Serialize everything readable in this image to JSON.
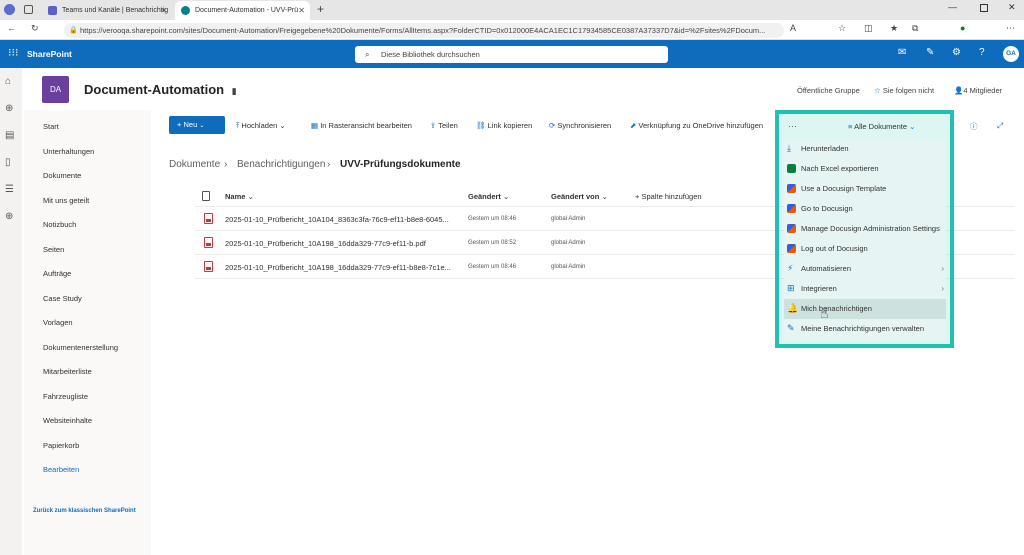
{
  "browser": {
    "tabs": [
      {
        "label": "Teams und Kanäle | Benachrichtig"
      },
      {
        "label": "Document-Automation - UVV-Prü"
      }
    ],
    "url": "https://verooqa.sharepoint.com/sites/Document-Automation/Freigegebene%20Dokumente/Forms/AllItems.aspx?FolderCTID=0x012000E4ACA1EC1C17934585CE0387A37337D7&id=%2Fsites%2FDocum..."
  },
  "suite": {
    "brand": "SharePoint",
    "search_placeholder": "Diese Bibliothek durchsuchen",
    "avatar": "GA"
  },
  "site": {
    "logo": "DA",
    "title": "Document-Automation",
    "group": "Öffentliche Gruppe",
    "follow": "Sie folgen nicht",
    "members": "4 Mitglieder"
  },
  "nav": {
    "items": [
      "Start",
      "Unterhaltungen",
      "Dokumente",
      "Mit uns geteilt",
      "Notizbuch",
      "Seiten",
      "Aufträge",
      "Case Study",
      "Vorlagen",
      "Dokumentenerstellung",
      "Mitarbeiterliste",
      "Fahrzeugliste",
      "Websiteinhalte",
      "Papierkorb"
    ],
    "edit": "Bearbeiten",
    "classic": "Zurück zum klassischen SharePoint"
  },
  "commands": {
    "new": "Neu",
    "upload": "Hochladen",
    "grid": "In Rasteransicht bearbeiten",
    "share": "Teilen",
    "copylink": "Link kopieren",
    "sync": "Synchronisieren",
    "onedrive": "Verknüpfung zu OneDrive hinzufügen",
    "more": "···",
    "view": "Alle Dokumente"
  },
  "breadcrumb": [
    "Dokumente",
    "Benachrichtigungen",
    "UVV-Prüfungsdokumente"
  ],
  "columns": {
    "name": "Name",
    "modified": "Geändert",
    "modified_by": "Geändert von",
    "add": "Spalte hinzufügen"
  },
  "files": [
    {
      "name": "2025-01-10_Prüfbericht_10A104_8363c3fa-76c9-ef11-b8e8-6045...",
      "modified": "Gestern um 08:46",
      "by": "global Admin"
    },
    {
      "name": "2025-01-10_Prüfbericht_10A198_16dda329-77c9-ef11-b.pdf",
      "modified": "Gestern um 08:52",
      "by": "global Admin"
    },
    {
      "name": "2025-01-10_Prüfbericht_10A198_16dda329-77c9-ef11-b8e8-7c1e...",
      "modified": "Gestern um 08:46",
      "by": "global Admin"
    }
  ],
  "menu": [
    {
      "label": "Herunterladen",
      "icon": "download-icon",
      "color": "#0f6cbd"
    },
    {
      "label": "Nach Excel exportieren",
      "icon": "excel-icon",
      "color": "#107c41"
    },
    {
      "label": "Use a Docusign Template",
      "icon": "docusign-icon",
      "color": "#3b5bdb"
    },
    {
      "label": "Go to Docusign",
      "icon": "docusign-icon",
      "color": "#3b5bdb"
    },
    {
      "label": "Manage Docusign Administration Settings",
      "icon": "docusign-icon",
      "color": "#3b5bdb"
    },
    {
      "label": "Log out of Docusign",
      "icon": "docusign-icon",
      "color": "#3b5bdb"
    },
    {
      "label": "Automatisieren",
      "icon": "automate-icon",
      "color": "#0f6cbd",
      "sub": "›"
    },
    {
      "label": "Integrieren",
      "icon": "integrate-icon",
      "color": "#0f6cbd",
      "sub": "›"
    },
    {
      "label": "Mich benachrichtigen",
      "icon": "bell-icon",
      "color": "#0f6cbd"
    },
    {
      "label": "Meine Benachrichtigungen verwalten",
      "icon": "manage-alerts-icon",
      "color": "#0f6cbd"
    }
  ]
}
